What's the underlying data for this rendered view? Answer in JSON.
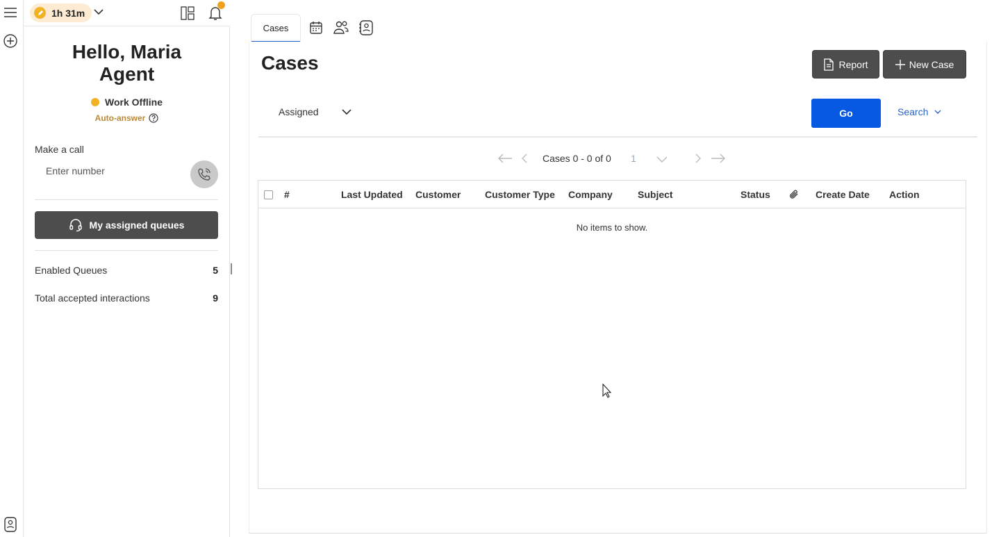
{
  "agent": {
    "timer": "1h 31m",
    "greeting": "Hello, Maria Agent",
    "status": "Work Offline",
    "status_color": "#f1b224",
    "auto_answer": "Auto-answer",
    "make_call_label": "Make a call",
    "number_placeholder": "Enter number",
    "queues_button": "My assigned queues",
    "stats": [
      {
        "label": "Enabled Queues",
        "value": "5"
      },
      {
        "label": "Total accepted interactions",
        "value": "9"
      }
    ]
  },
  "tabs": {
    "active": "Cases",
    "icons": [
      "calendar-icon",
      "people-icon",
      "contacts-icon"
    ]
  },
  "cases": {
    "title": "Cases",
    "report_button": "Report",
    "new_case_button": "New Case",
    "filter_value": "Assigned",
    "go_button": "Go",
    "search_link": "Search",
    "pager_text": "Cases 0 - 0 of 0",
    "page_number": "1",
    "columns": [
      "#",
      "Last Updated",
      "Customer",
      "Customer Type",
      "Company",
      "Subject",
      "Status",
      "",
      "Create Date",
      "Action"
    ],
    "empty_message": "No items to show."
  },
  "colors": {
    "accent": "#0859e2",
    "dark_button": "#4d4d4d",
    "notification": "#f0a21f"
  }
}
